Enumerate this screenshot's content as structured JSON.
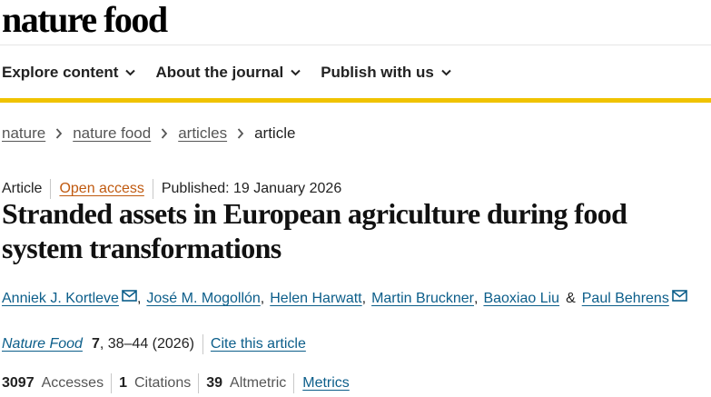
{
  "logo": {
    "text": "nature food"
  },
  "nav": {
    "items": [
      {
        "label": "Explore content",
        "icon": "chevron-down-icon"
      },
      {
        "label": "About the journal",
        "icon": "chevron-down-icon"
      },
      {
        "label": "Publish with us",
        "icon": "chevron-down-icon"
      }
    ]
  },
  "colors": {
    "accent_bar": "#f0c300",
    "link": "#0c5e8a",
    "open_access": "#c05a10"
  },
  "breadcrumb": {
    "items": [
      "nature",
      "nature food",
      "articles"
    ],
    "current": "article"
  },
  "article_meta": {
    "type": "Article",
    "open_access": "Open access",
    "published": "Published: 19 January 2026"
  },
  "title": "Stranded assets in European agriculture during food system transformations",
  "authors": [
    {
      "name": "Anniek J. Kortleve",
      "email_icon": true
    },
    {
      "name": "José M. Mogollón",
      "email_icon": false
    },
    {
      "name": "Helen Harwatt",
      "email_icon": false
    },
    {
      "name": "Martin Bruckner",
      "email_icon": false
    },
    {
      "name": "Baoxiao Liu",
      "email_icon": false
    },
    {
      "name": "Paul Behrens",
      "email_icon": true
    }
  ],
  "authors_amp": "&",
  "citation": {
    "journal": "Nature Food",
    "volume": "7",
    "pages": ", 38–44 (2026)",
    "cite_link": "Cite this article"
  },
  "metrics": {
    "accesses_count": "3097",
    "accesses_label": "Accesses",
    "citations_count": "1",
    "citations_label": "Citations",
    "altmetric_count": "39",
    "altmetric_label": "Altmetric",
    "metrics_link": "Metrics"
  }
}
